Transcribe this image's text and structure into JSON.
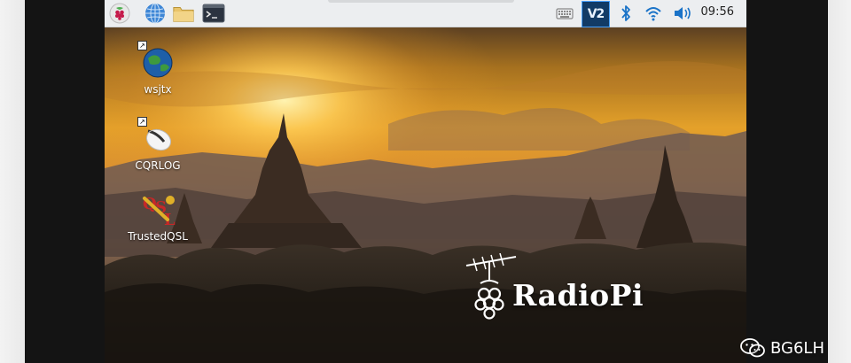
{
  "taskbar": {
    "launchers": [
      {
        "name": "raspberry-menu",
        "icon": "raspberry-icon"
      },
      {
        "name": "web-browser",
        "icon": "globe-icon"
      },
      {
        "name": "file-manager",
        "icon": "folder-icon"
      },
      {
        "name": "terminal",
        "icon": "terminal-icon"
      }
    ],
    "tray": [
      {
        "name": "keyboard",
        "icon": "keyboard-icon"
      },
      {
        "name": "vnc",
        "icon": "vnc-icon",
        "text": "V2"
      },
      {
        "name": "bluetooth",
        "icon": "bluetooth-icon"
      },
      {
        "name": "wifi",
        "icon": "wifi-icon"
      },
      {
        "name": "volume",
        "icon": "speaker-icon"
      }
    ],
    "clock": "09:56"
  },
  "desktop": {
    "icons": [
      {
        "label": "wsjtx"
      },
      {
        "label": "CQRLOG"
      },
      {
        "label": "TrustedQSL"
      }
    ],
    "logo_text": "RadioPi"
  },
  "watermark": {
    "text": "BG6LH"
  },
  "colors": {
    "taskbar_bg": "#eceef0",
    "vnc_accent": "#1f6fbf",
    "bluetooth": "#1a73c8",
    "sky_top": "#6b4a27",
    "sun": "#ffd66b",
    "frame": "#141414"
  }
}
